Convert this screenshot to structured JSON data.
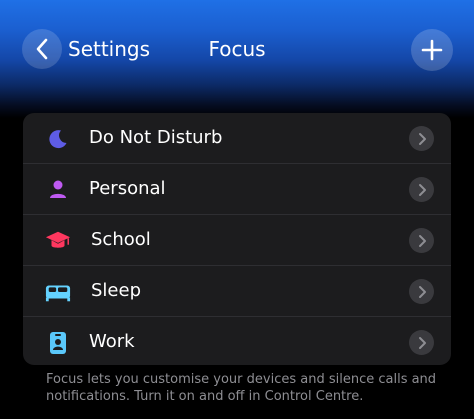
{
  "nav": {
    "back_label": "Settings",
    "title": "Focus",
    "back_icon": "chevron-left-icon",
    "add_icon": "plus-icon"
  },
  "focus_list": {
    "items": [
      {
        "label": "Do Not Disturb",
        "icon": "moon-icon",
        "color": "#5e5ce6"
      },
      {
        "label": "Personal",
        "icon": "person-icon",
        "color": "#bf5af2"
      },
      {
        "label": "School",
        "icon": "graduation-cap-icon",
        "color": "#ff375f"
      },
      {
        "label": "Sleep",
        "icon": "bed-icon",
        "color": "#64d2ff"
      },
      {
        "label": "Work",
        "icon": "id-badge-icon",
        "color": "#5ac8fa"
      }
    ]
  },
  "footer": {
    "text": "Focus lets you customise your devices and silence calls and notifications. Turn it on and off in Control Centre."
  },
  "colors": {
    "accent": "#1f70e6",
    "list_background": "#1c1c1e",
    "secondary_text": "#8e8e93"
  }
}
